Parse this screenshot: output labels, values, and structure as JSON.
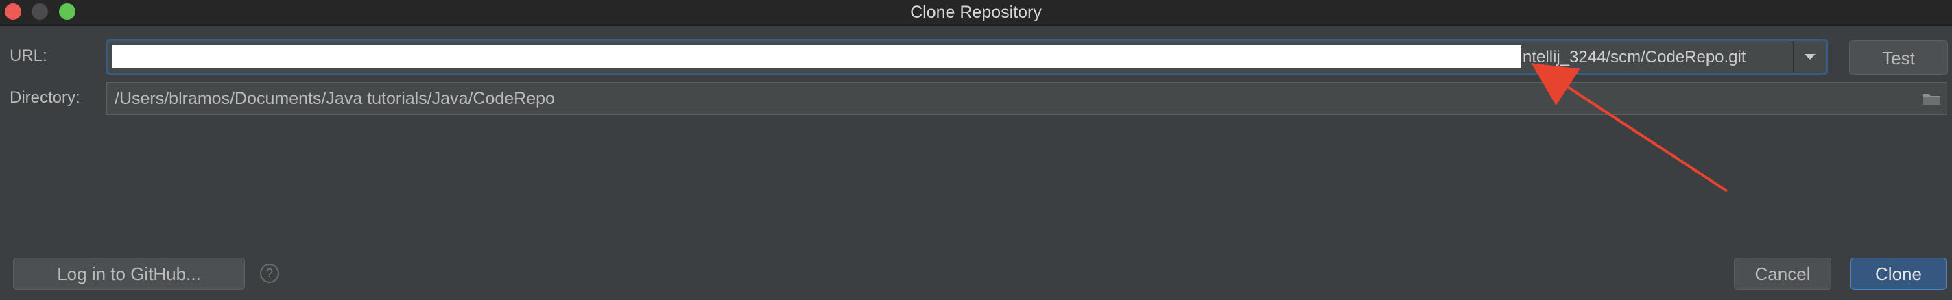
{
  "window": {
    "title": "Clone Repository",
    "controls": {
      "close": "close-button",
      "minimize": "minimize-button",
      "maximize": "maximize-button"
    }
  },
  "form": {
    "url_label": "URL:",
    "url_value_visible": "ntellij_3244/scm/CodeRepo.git",
    "directory_label": "Directory:",
    "directory_value": "/Users/blramos/Documents/Java tutorials/Java/CodeRepo"
  },
  "buttons": {
    "test": "Test",
    "github": "Log in to GitHub...",
    "cancel": "Cancel",
    "clone": "Clone",
    "help": "?"
  },
  "icons": {
    "url_dropdown": "chevron-down-icon",
    "folder": "folder-icon",
    "help": "help-icon",
    "annotation": "red-arrow-icon"
  },
  "colors": {
    "background": "#3c3f41",
    "titlebar": "#262626",
    "field_background": "#45494a",
    "focus_border": "#395c82",
    "button": "#4c5052",
    "primary_button": "#365880",
    "annotation_arrow": "#e8432f",
    "text": "#bbbbbb"
  }
}
